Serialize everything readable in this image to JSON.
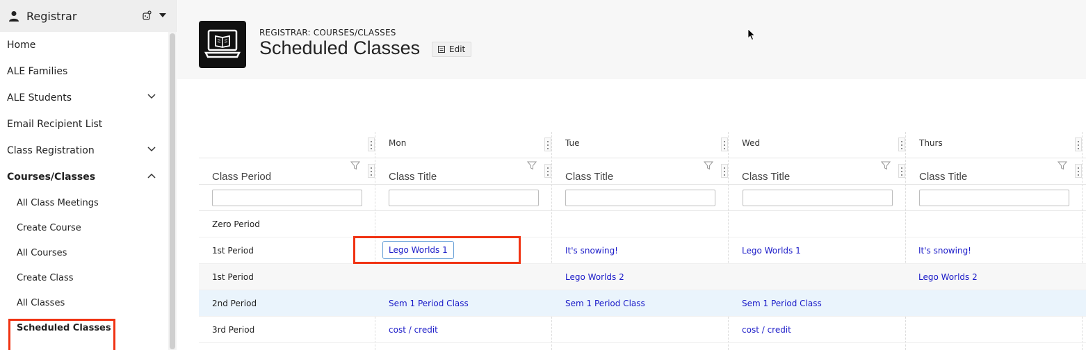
{
  "sidebar": {
    "header_title": "Registrar",
    "items": [
      {
        "label": "Home"
      },
      {
        "label": "ALE Families"
      },
      {
        "label": "ALE Students"
      },
      {
        "label": "Email Recipient List"
      },
      {
        "label": "Class Registration"
      },
      {
        "label": "Courses/Classes"
      }
    ],
    "sub_items": [
      {
        "label": "All Class Meetings"
      },
      {
        "label": "Create Course"
      },
      {
        "label": "All Courses"
      },
      {
        "label": "Create Class"
      },
      {
        "label": "All Classes"
      },
      {
        "label": "Scheduled Classes"
      }
    ]
  },
  "header": {
    "breadcrumb": "REGISTRAR: COURSES/CLASSES",
    "title": "Scheduled Classes",
    "edit_label": "Edit"
  },
  "grid": {
    "days": [
      "Mon",
      "Tue",
      "Wed",
      "Thurs"
    ],
    "col_period": "Class Period",
    "col_title": "Class Title",
    "rows": [
      {
        "period": "Zero Period",
        "mon": "",
        "tue": "",
        "wed": "",
        "thu": ""
      },
      {
        "period": "1st Period",
        "mon": "Lego Worlds 1",
        "tue": "It's snowing!",
        "wed": "Lego Worlds 1",
        "thu": "It's snowing!"
      },
      {
        "period": "1st Period",
        "mon": "",
        "tue": "Lego Worlds 2",
        "wed": "",
        "thu": "Lego Worlds 2"
      },
      {
        "period": "2nd Period",
        "mon": "Sem 1 Period Class",
        "tue": "Sem 1 Period Class",
        "wed": "Sem 1 Period Class",
        "thu": ""
      },
      {
        "period": "3rd Period",
        "mon": "cost / credit",
        "tue": "",
        "wed": "cost / credit",
        "thu": ""
      }
    ]
  },
  "colors": {
    "link": "#1a1ac8",
    "highlight": "#f03313",
    "selected_row": "#eaf4fc"
  }
}
